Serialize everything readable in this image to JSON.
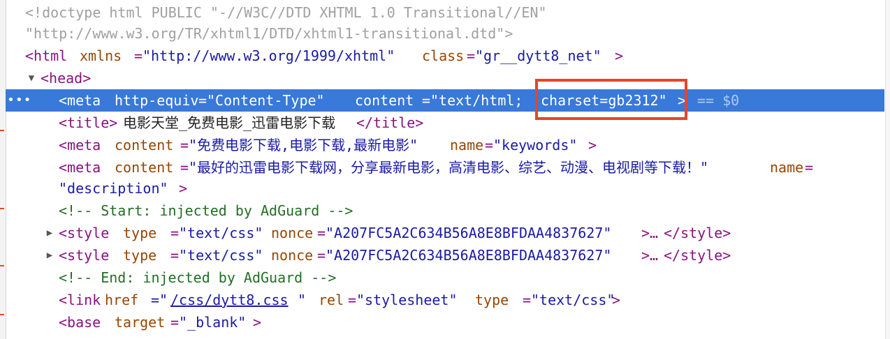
{
  "elements_tree": {
    "doctype_line1": "<!doctype html PUBLIC \"-//W3C//DTD XHTML 1.0 Transitional//EN\"",
    "doctype_line2": "\"http://www.w3.org/TR/xhtml1/DTD/xhtml1-transitional.dtd\">",
    "html_tag": {
      "open": "<html",
      "attr1_name": "xmlns",
      "attr1_value": "\"http://www.w3.org/1999/xhtml\"",
      "attr2_name": "class",
      "attr2_value": "\"gr__dytt8_net\"",
      "close": ">"
    },
    "head_tag": {
      "open": "<head>"
    },
    "selected_meta": {
      "dots": "•••",
      "open": "<meta",
      "attr1_name": "http-equiv",
      "attr1_value": "\"Content-Type\"",
      "attr2_name": "content",
      "attr2_value_part1": "\"text/html;",
      "attr2_value_part2": "charset=gb2312\"",
      "close": ">",
      "ref": "== $0"
    },
    "title_tag": {
      "open": "<title>",
      "text": "电影天堂_免费电影_迅雷电影下载",
      "close": "</title>"
    },
    "meta_keywords": {
      "open": "<meta",
      "attr1_name": "content",
      "attr1_value": "\"免费电影下载,电影下载,最新电影\"",
      "attr2_name": "name",
      "attr2_value": "\"keywords\"",
      "close": ">"
    },
    "meta_description": {
      "open": "<meta",
      "attr1_name": "content",
      "attr1_value": "\"最好的迅雷电影下载网，分享最新电影，高清电影、综艺、动漫、电视剧等下载！\"",
      "attr2_name": "name",
      "attr2_value": "\"description\"",
      "close": ">"
    },
    "comment_start": "<!-- Start: injected by AdGuard -->",
    "style1": {
      "open": "<style",
      "attr1_name": "type",
      "attr1_value": "\"text/css\"",
      "attr2_name": "nonce",
      "attr2_value": "\"A207FC5A2C634B56A8E8BFDAA4837627\"",
      "collapsed": ">…",
      "close": "</style>"
    },
    "style2": {
      "open": "<style",
      "attr1_name": "type",
      "attr1_value": "\"text/css\"",
      "attr2_name": "nonce",
      "attr2_value": "\"A207FC5A2C634B56A8E8BFDAA4837627\"",
      "collapsed": ">…",
      "close": "</style>"
    },
    "comment_end": "<!-- End: injected by AdGuard -->",
    "link_tag": {
      "open": "<link",
      "attr1_name": "href",
      "attr1_value_q1": "=\"",
      "attr1_value": "/css/dytt8.css",
      "attr1_value_q2": "\"",
      "attr2_name": "rel",
      "attr2_value": "\"stylesheet\"",
      "attr3_name": "type",
      "attr3_value": "\"text/css\"",
      "close": ">"
    },
    "base_tag": {
      "open": "<base",
      "attr1_name": "target",
      "attr1_value": "\"_blank\"",
      "close": ">"
    }
  },
  "icons": {
    "expanded": "▼",
    "collapsed": "▶"
  },
  "colors": {
    "selection": "#3879d9",
    "highlight_box": "#e8432b",
    "tag": "#881280",
    "attribute": "#994500",
    "value": "#1a1aa6",
    "comment": "#236e25"
  }
}
